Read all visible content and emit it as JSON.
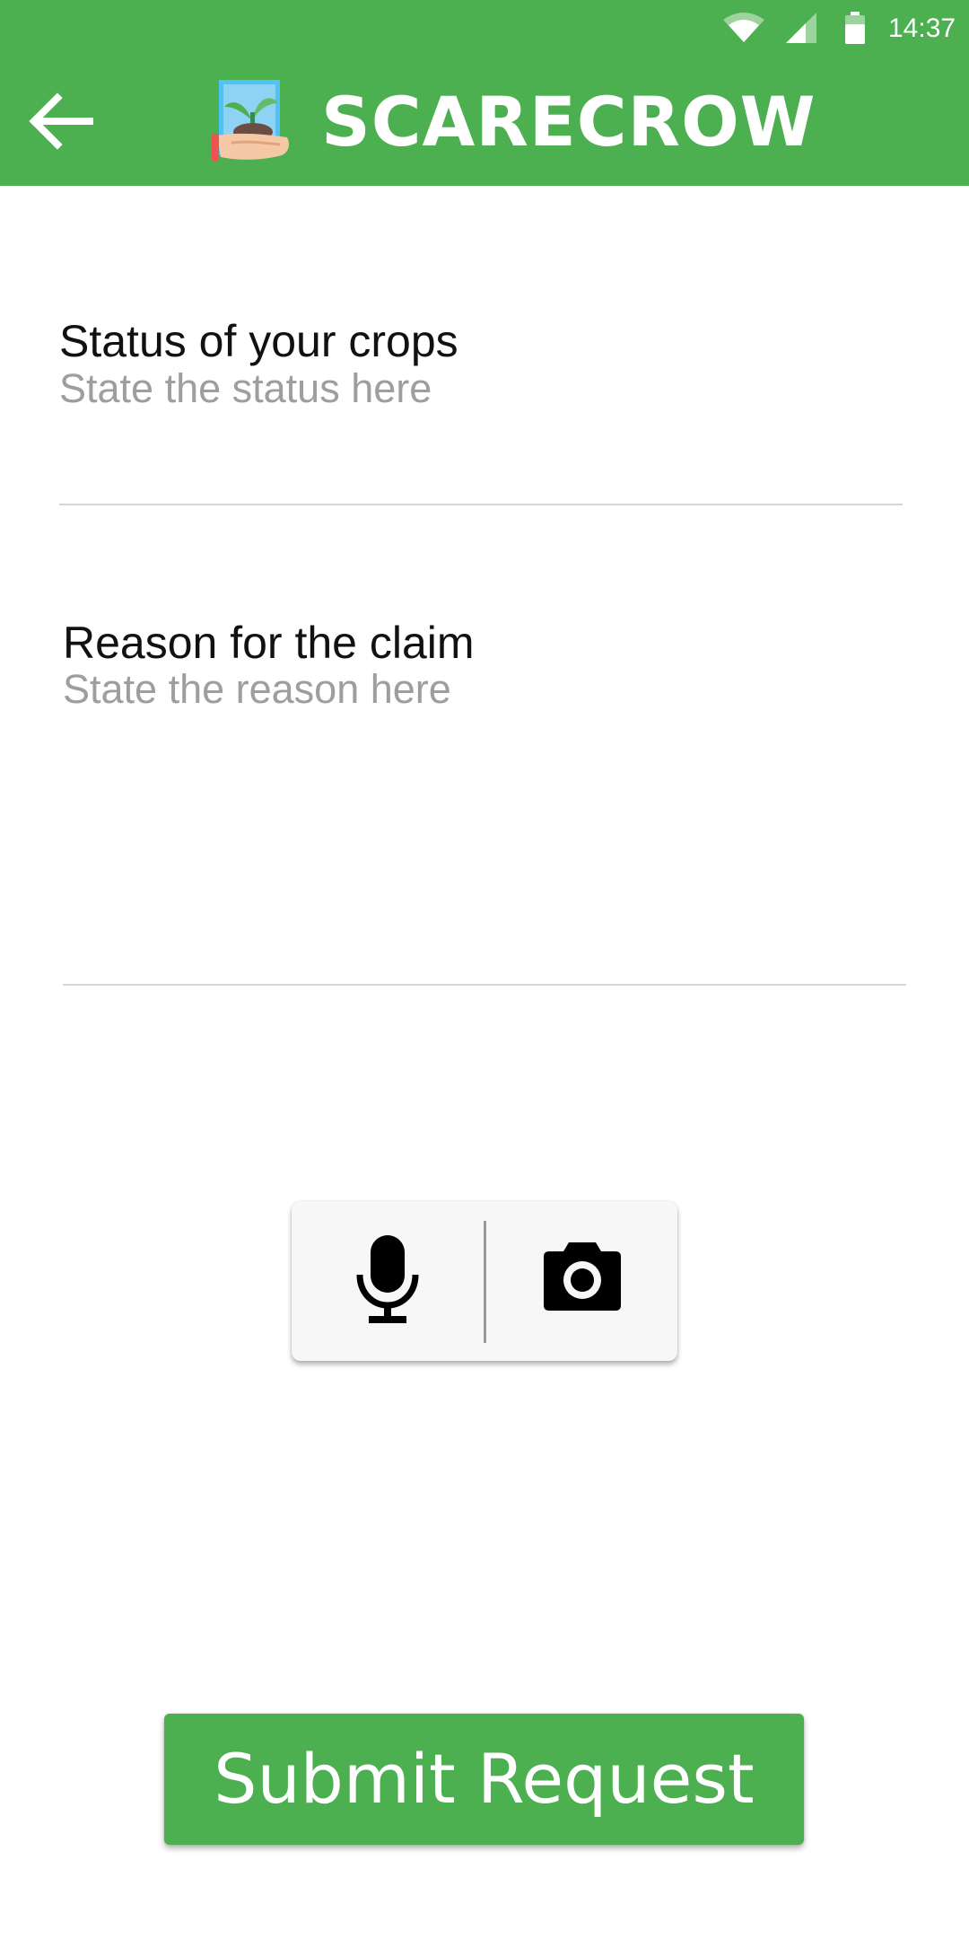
{
  "status_bar": {
    "time": "14:37",
    "icons": [
      "wifi-icon",
      "cell-signal-icon",
      "battery-icon"
    ]
  },
  "app_bar": {
    "title": "SCARECROW",
    "back_icon": "arrow-left-icon",
    "logo_icon": "hand-holding-seedling-icon"
  },
  "form": {
    "crop_status": {
      "label": "Status of your crops",
      "placeholder": "State the status here",
      "value": ""
    },
    "claim_reason": {
      "label": "Reason for the claim",
      "placeholder": "State the reason here",
      "value": ""
    }
  },
  "media_toolbar": {
    "record_icon": "microphone-icon",
    "photo_icon": "camera-icon"
  },
  "submit": {
    "label": "Submit Request"
  },
  "colors": {
    "primary": "#4caf50",
    "placeholder": "#9e9e9e",
    "divider": "#d6d6d6",
    "toolbar_bg": "#f7f7f7"
  }
}
